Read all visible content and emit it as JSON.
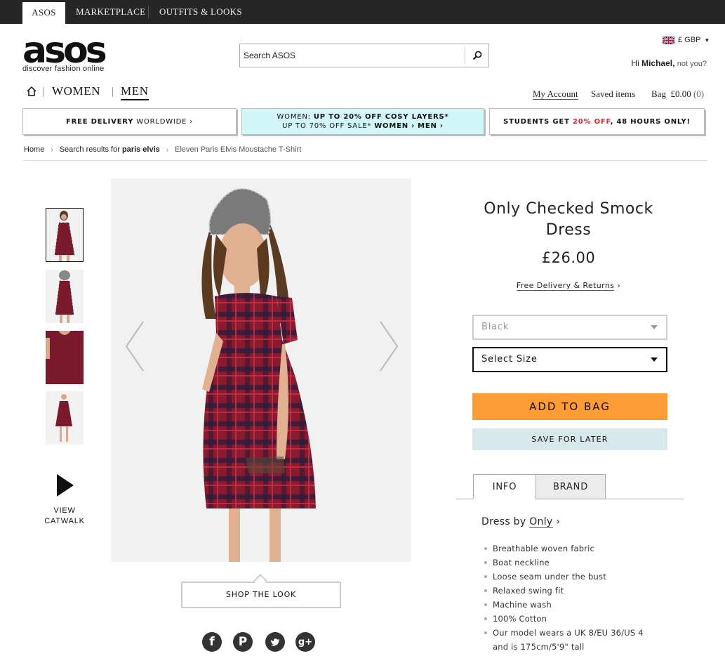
{
  "topnav": {
    "tabs": [
      "ASOS",
      "MARKETPLACE",
      "OUTFITS & LOOKS"
    ]
  },
  "header": {
    "logo_text": "asos",
    "tagline": "discover fashion online",
    "search_placeholder": "Search ASOS",
    "currency": "£ GBP",
    "greeting_prefix": "Hi",
    "user_name": "Michael,",
    "not_you": "not you?"
  },
  "nav": {
    "women": "WOMEN",
    "men": "MEN",
    "my_account": "My Account",
    "saved_items": "Saved items",
    "bag_label": "Bag",
    "bag_total": "£0.00",
    "bag_count": "(0)"
  },
  "promos": {
    "delivery_bold": "FREE DELIVERY",
    "delivery_rest": "WORLDWIDE ›",
    "women_prefix": "WOMEN:",
    "women_bold": "UP TO 20% OFF COSY LAYERS*",
    "women_line2_prefix": "UP TO 70% OFF SALE*",
    "women_line2_women": "WOMEN ›",
    "women_line2_men": "MEN ›",
    "students_a": "STUDENTS GET",
    "students_red": "20% OFF",
    "students_b": ", 48 HOURS ONLY!"
  },
  "breadcrumb": {
    "home": "Home",
    "search_prefix": "Search results for",
    "search_term": "paris elvis",
    "current": "Eleven Paris Elvis Moustache T-Shirt"
  },
  "media": {
    "view_catwalk_1": "VIEW",
    "view_catwalk_2": "CATWALK",
    "shop_the_look": "SHOP THE LOOK"
  },
  "social": [
    "facebook-icon",
    "pinterest-icon",
    "twitter-icon",
    "google-plus-icon"
  ],
  "product": {
    "title_line1": "Only Checked Smock",
    "title_line2": "Dress",
    "price": "£26.00",
    "delivery_link": "Free Delivery & Returns",
    "delivery_arrow": "›",
    "colour_value": "Black",
    "size_placeholder": "Select Size",
    "add_to_bag": "ADD TO BAG",
    "save_for_later": "SAVE FOR LATER",
    "tab_info": "INFO",
    "tab_brand": "BRAND",
    "dress_by_prefix": "Dress by",
    "brand_name": "Only",
    "brand_arrow": "›",
    "features": [
      "Breathable woven fabric",
      "Boat neckline",
      "Loose seam under the bust",
      "Relaxed swing fit",
      "Machine wash",
      "100% Cotton",
      "Our model wears a UK 8/EU 36/US 4"
    ],
    "feature_cont": "and is 175cm/5'9\" tall"
  },
  "colors": {
    "topbar": "#262626",
    "promo_highlight": "#d2f5f7",
    "add_to_bag": "#fd9b35",
    "save_for_later": "#d6e8ec",
    "sale_red": "#e0202b",
    "dress_red": "#8a1a2e"
  }
}
